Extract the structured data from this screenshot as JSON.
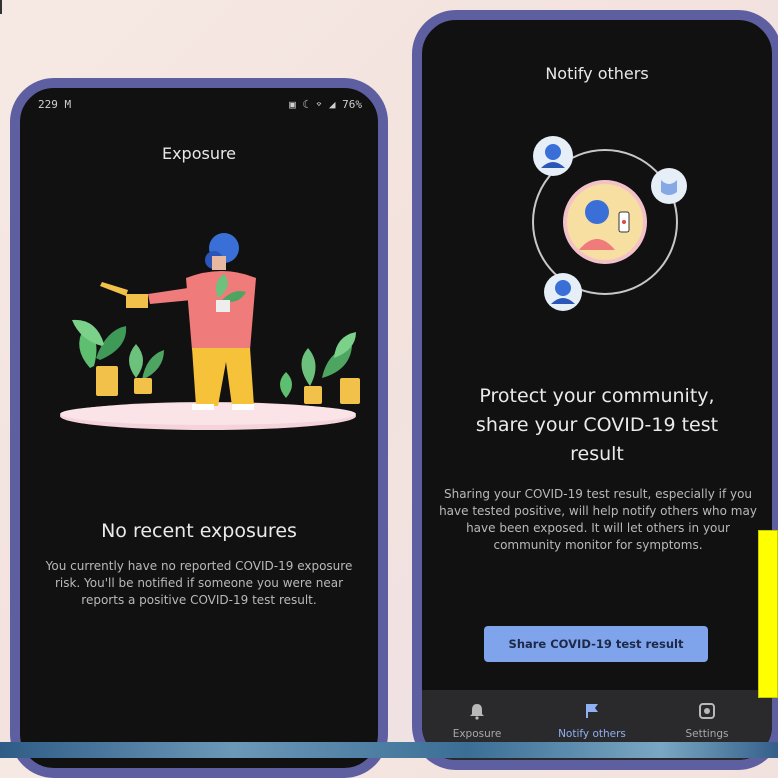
{
  "left_phone": {
    "status_time": "229 M",
    "status_icons": "▣ ☾ ⌔ ◢ 76%",
    "title": "Exposure",
    "headline": "No recent exposures",
    "body": "You currently have no reported COVID-19 exposure risk. You'll be notified if someone you were near reports a positive COVID-19 test result."
  },
  "right_phone": {
    "title": "Notify others",
    "headline": "Protect your community, share your COVID-19 test result",
    "body": "Sharing your COVID-19 test result, especially if you have tested positive, will help notify others who may have been exposed. It will let others in your community monitor for symptoms.",
    "cta_label": "Share COVID-19 test result",
    "nav": [
      {
        "label": "Exposure",
        "icon": "bell-icon",
        "active": false
      },
      {
        "label": "Notify others",
        "icon": "flag-icon",
        "active": true
      },
      {
        "label": "Settings",
        "icon": "settings-icon",
        "active": false
      }
    ]
  },
  "colors": {
    "phone_frame": "#5d5fa0",
    "screen_bg": "#111112",
    "accent_button": "#7fa4ec",
    "nav_active": "#8fb0f2",
    "highlight_card": "#ffff00"
  }
}
